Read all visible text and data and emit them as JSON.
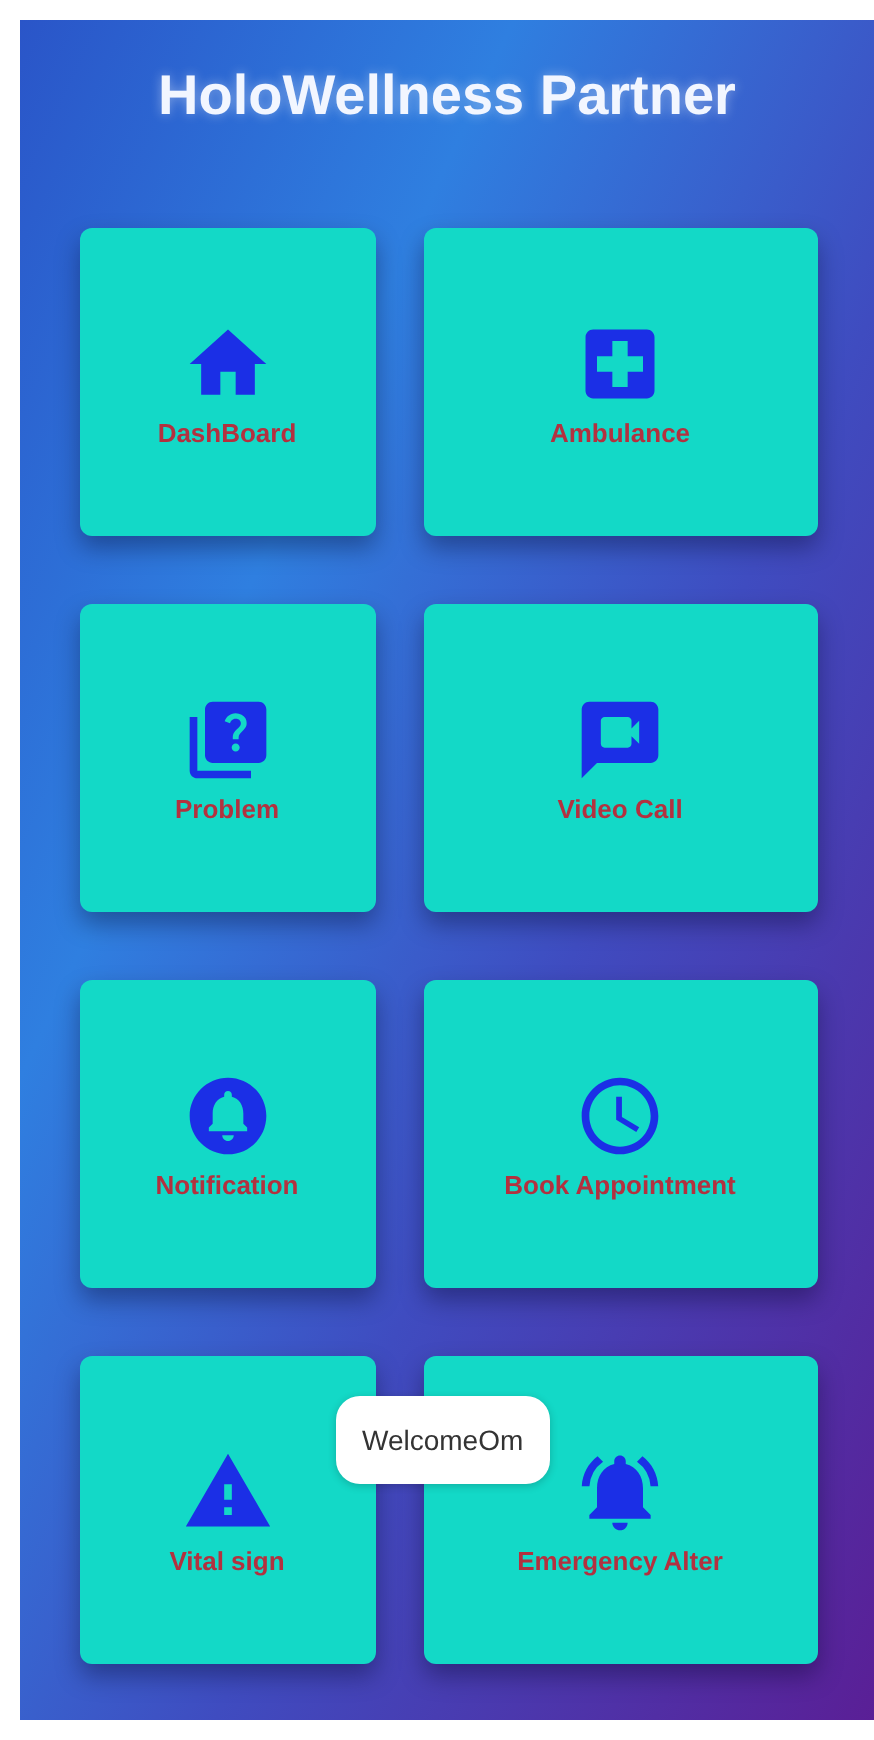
{
  "title": "HoloWellness Partner",
  "tiles": [
    {
      "label": "DashBoard",
      "kind": "home"
    },
    {
      "label": "Ambulance",
      "kind": "medical"
    },
    {
      "label": "Problem",
      "kind": "question"
    },
    {
      "label": "Video Call",
      "kind": "video"
    },
    {
      "label": "Notification",
      "kind": "bell"
    },
    {
      "label": "Book Appointment",
      "kind": "clock"
    },
    {
      "label": "Vital sign",
      "kind": "warning"
    },
    {
      "label": "Emergency Alter",
      "kind": "alarm"
    }
  ],
  "toast": "WelcomeOm"
}
